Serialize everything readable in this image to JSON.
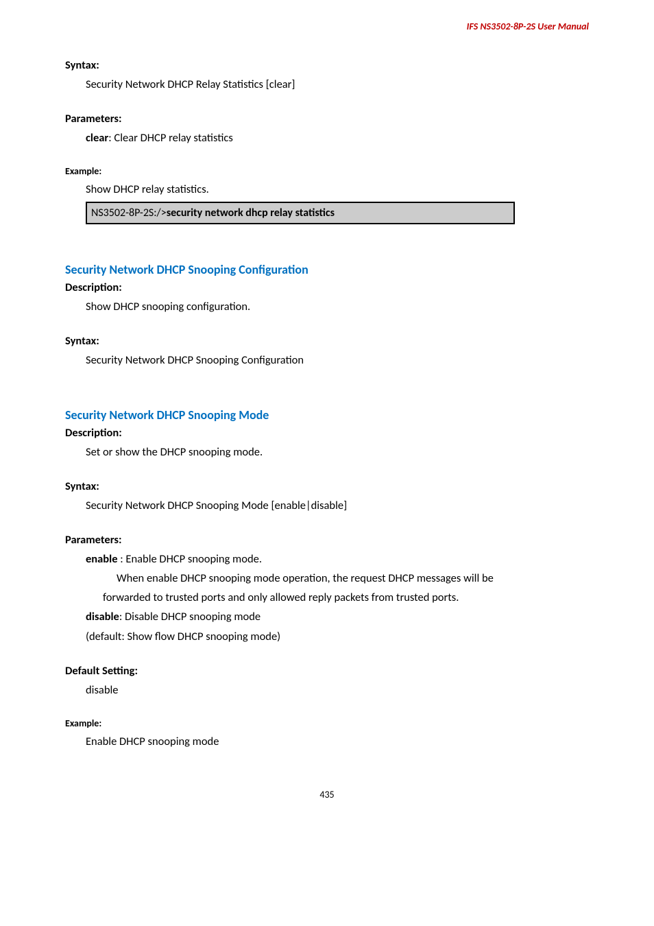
{
  "header": "IFS  NS3502-8P-2S  User  Manual",
  "s1": {
    "syntax_label": "Syntax:",
    "syntax_text": "Security Network DHCP Relay Statistics [clear]",
    "params_label": "Parameters:",
    "params_bold": "clear",
    "params_rest": ": Clear DHCP relay statistics",
    "example_label": "Example:",
    "example_text": "Show DHCP relay statistics.",
    "code_prefix": "NS3502-8P-2S:/>",
    "code_bold": "security network dhcp relay statistics"
  },
  "s2": {
    "title": "Security Network DHCP Snooping Configuration",
    "desc_label": "Description:",
    "desc_text": "Show DHCP snooping configuration.",
    "syntax_label": "Syntax:",
    "syntax_text": "Security Network DHCP Snooping Configuration"
  },
  "s3": {
    "title": "Security Network DHCP Snooping Mode",
    "desc_label": "Description:",
    "desc_text": "Set or show the DHCP snooping mode.",
    "syntax_label": "Syntax:",
    "syntax_text": "Security Network DHCP Snooping Mode [enable|disable]",
    "params_label": "Parameters:",
    "enable_bold": "enable",
    "enable_rest": " : Enable DHCP snooping mode.",
    "enable_line2": "When enable DHCP snooping mode operation, the request DHCP messages will be",
    "enable_line3": "forwarded to trusted ports and only allowed reply packets from trusted ports.",
    "disable_bold": "disable",
    "disable_rest": ": Disable DHCP snooping mode",
    "default_line": "(default: Show flow DHCP snooping mode)",
    "default_label": "Default Setting:",
    "default_text": "disable",
    "example_label": "Example:",
    "example_text": "Enable DHCP snooping mode"
  },
  "page_num": "435"
}
